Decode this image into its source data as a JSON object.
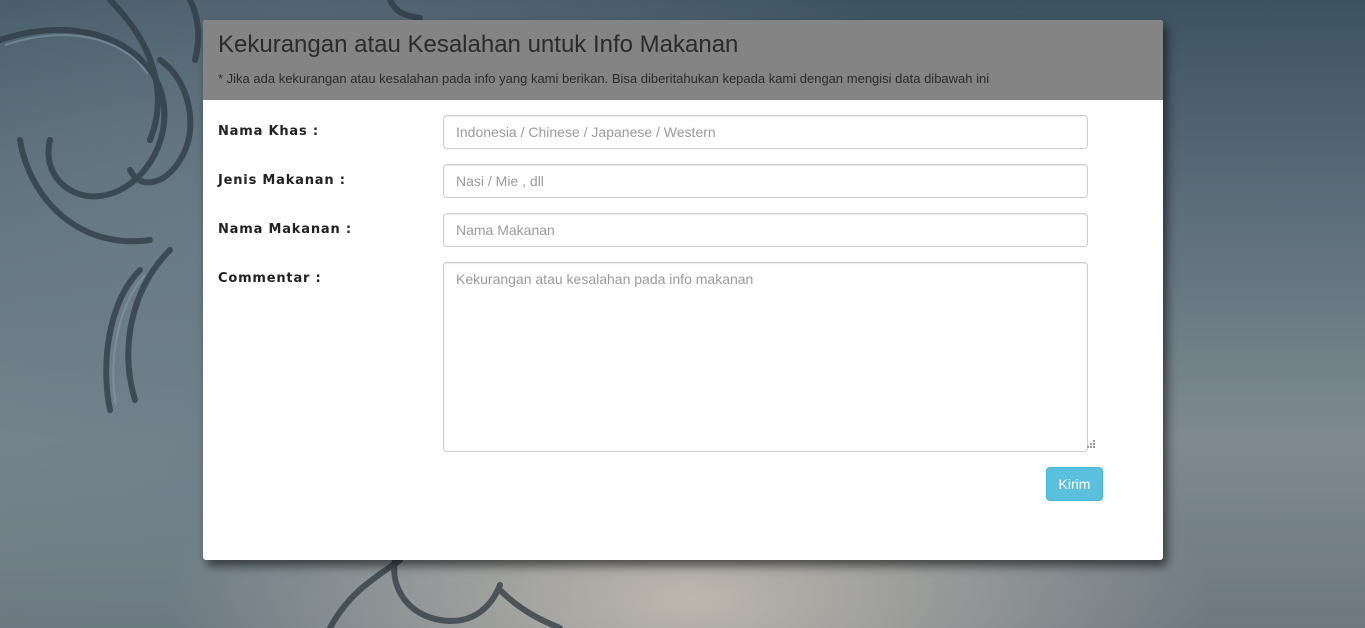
{
  "modal": {
    "title": "Kekurangan atau Kesalahan untuk Info Makanan",
    "subtitle": "* Jika ada kekurangan atau kesalahan pada info yang kami berikan. Bisa diberitahukan kepada kami dengan mengisi data dibawah ini"
  },
  "form": {
    "nama_khas": {
      "label": "Nama Khas :",
      "value": "",
      "placeholder": "Indonesia / Chinese / Japanese / Western"
    },
    "jenis_makanan": {
      "label": "Jenis Makanan :",
      "value": "",
      "placeholder": "Nasi / Mie , dll"
    },
    "nama_makanan": {
      "label": "Nama Makanan :",
      "value": "",
      "placeholder": "Nama Makanan"
    },
    "commentar": {
      "label": "Commentar :",
      "value": "",
      "placeholder": "Kekurangan atau kesalahan pada info makanan"
    },
    "submit_label": "Kirim"
  },
  "colors": {
    "header_bg": "#848484",
    "button_bg": "#5bc0de"
  }
}
